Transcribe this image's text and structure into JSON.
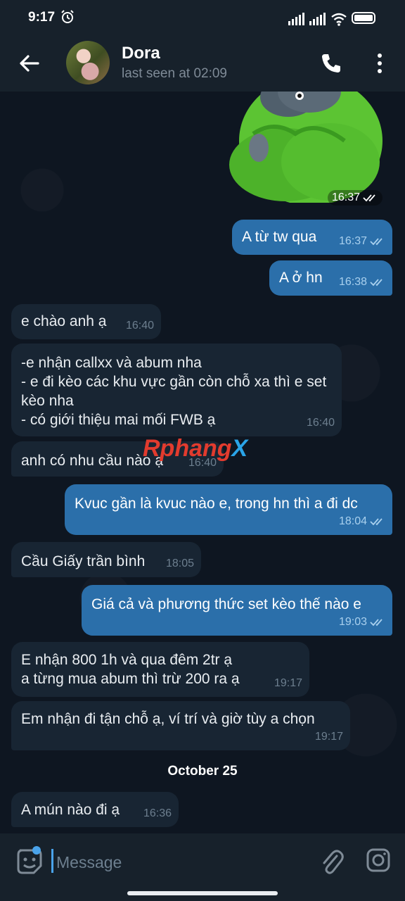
{
  "status_bar": {
    "time": "9:17"
  },
  "header": {
    "contact_name": "Dora",
    "last_seen": "last seen at 02:09"
  },
  "sticker": {
    "time": "16:37"
  },
  "messages": [
    {
      "dir": "out",
      "text": "A từ tw qua",
      "time": "16:37",
      "read": true
    },
    {
      "dir": "out",
      "text": "A ở hn",
      "time": "16:38",
      "read": true
    },
    {
      "dir": "in",
      "text": "e chào anh ạ",
      "time": "16:40"
    },
    {
      "dir": "in",
      "text": "-e nhận callxx và abum nha\n- e đi kèo các khu vực gần còn chỗ xa thì e set kèo nha\n- có giới thiệu mai mối FWB ạ",
      "time": "16:40"
    },
    {
      "dir": "in",
      "text": "anh có nhu cầu nào ạ",
      "time": "16:40"
    },
    {
      "dir": "out",
      "text": "Kvuc gần là kvuc nào e, trong hn thì a đi dc",
      "time": "18:04",
      "read": true
    },
    {
      "dir": "in",
      "text": "Cầu Giấy trần bình",
      "time": "18:05"
    },
    {
      "dir": "out",
      "text": "Giá cả và phương thức set kèo thế nào e",
      "time": "19:03",
      "read": true
    },
    {
      "dir": "in",
      "text": "E nhận 800 1h và qua đêm 2tr ạ\na từng mua abum thì trừ 200 ra ạ",
      "time": "19:17"
    },
    {
      "dir": "in",
      "text": "Em nhận đi tận chỗ ạ, ví trí và giờ tùy a chọn",
      "time": "19:17"
    },
    {
      "dir": "in",
      "text": "A mún nào đi ạ",
      "time": "16:36"
    }
  ],
  "date_separator": "October 25",
  "watermark": {
    "part1": "Rphang",
    "part2": "X"
  },
  "input": {
    "placeholder": "Message"
  },
  "icons": {
    "back": "arrow-left-icon",
    "call": "phone-icon",
    "menu": "more-vert-icon",
    "emoji": "sticker-emoji-icon",
    "attach": "paperclip-icon",
    "camera": "instagram-camera-icon"
  },
  "colors": {
    "background": "#0e1621",
    "bar": "#17212b",
    "incoming_bubble": "#182533",
    "outgoing_bubble": "#2b6faa",
    "accent": "#4aa3ea"
  }
}
